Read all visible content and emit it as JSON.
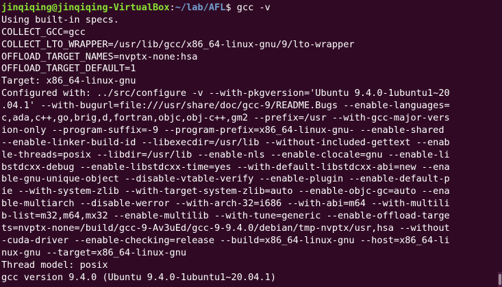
{
  "prompt": {
    "user_host": "jinqiqing@jinqiqing-VirtualBox",
    "colon": ":",
    "path": "~/lab/AFL",
    "sign": "$ ",
    "command": "gcc -v"
  },
  "output_lines": [
    "Using built-in specs.",
    "COLLECT_GCC=gcc",
    "COLLECT_LTO_WRAPPER=/usr/lib/gcc/x86_64-linux-gnu/9/lto-wrapper",
    "OFFLOAD_TARGET_NAMES=nvptx-none:hsa",
    "OFFLOAD_TARGET_DEFAULT=1",
    "Target: x86_64-linux-gnu",
    "Configured with: ../src/configure -v --with-pkgversion='Ubuntu 9.4.0-1ubuntu1~20",
    ".04.1' --with-bugurl=file:///usr/share/doc/gcc-9/README.Bugs --enable-languages=",
    "c,ada,c++,go,brig,d,fortran,objc,obj-c++,gm2 --prefix=/usr --with-gcc-major-vers",
    "ion-only --program-suffix=-9 --program-prefix=x86_64-linux-gnu- --enable-shared ",
    "--enable-linker-build-id --libexecdir=/usr/lib --without-included-gettext --enab",
    "le-threads=posix --libdir=/usr/lib --enable-nls --enable-clocale=gnu --enable-li",
    "bstdcxx-debug --enable-libstdcxx-time=yes --with-default-libstdcxx-abi=new --ena",
    "ble-gnu-unique-object --disable-vtable-verify --enable-plugin --enable-default-p",
    "ie --with-system-zlib --with-target-system-zlib=auto --enable-objc-gc=auto --ena",
    "ble-multiarch --disable-werror --with-arch-32=i686 --with-abi=m64 --with-multili",
    "b-list=m32,m64,mx32 --enable-multilib --with-tune=generic --enable-offload-targe",
    "ts=nvptx-none=/build/gcc-9-Av3uEd/gcc-9-9.4.0/debian/tmp-nvptx/usr,hsa --without",
    "-cuda-driver --enable-checking=release --build=x86_64-linux-gnu --host=x86_64-li",
    "nux-gnu --target=x86_64-linux-gnu",
    "Thread model: posix",
    "gcc version 9.4.0 (Ubuntu 9.4.0-1ubuntu1~20.04.1)"
  ]
}
